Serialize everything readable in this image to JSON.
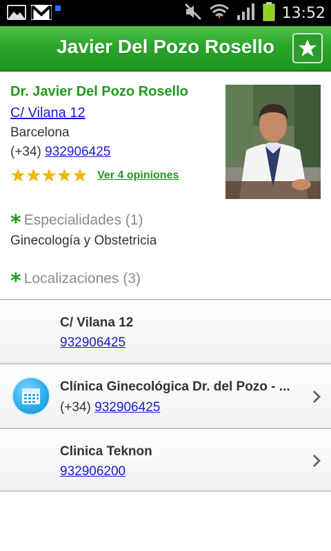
{
  "status_bar": {
    "time": "13:52",
    "icons": [
      "gallery-icon",
      "gmail-icon",
      "notification-dot-icon",
      "mute-icon",
      "wifi-icon",
      "signal-icon",
      "battery-icon"
    ]
  },
  "action_bar": {
    "title": "Javier Del Pozo Rosello",
    "favorite_icon": "star-icon"
  },
  "profile": {
    "name": "Dr. Javier Del Pozo Rosello",
    "address": "C/ Vilana 12",
    "city": "Barcelona",
    "phone_prefix": "(+34)",
    "phone": "932906425",
    "rating": 5,
    "rating_max": 5,
    "opinions_link": "Ver 4 opiniones"
  },
  "specialties": {
    "title": "Especialidades (1)",
    "items": [
      "Ginecología y Obstetricia"
    ]
  },
  "locations": {
    "title": "Localizaciones (3)",
    "items": [
      {
        "name": "C/ Vilana 12",
        "phone_prefix": "",
        "phone": "932906425"
      },
      {
        "name": "Clínica Ginecológica Dr. del Pozo - ...",
        "phone_prefix": "(+34)",
        "phone": "932906425",
        "icon": "calendar-icon"
      },
      {
        "name": "Clinica Teknon",
        "phone_prefix": "",
        "phone": "932906200"
      }
    ]
  },
  "colors": {
    "brand_green": "#1f9a1c",
    "link_blue": "#1a1ad0",
    "star_gold": "#f5b400"
  }
}
